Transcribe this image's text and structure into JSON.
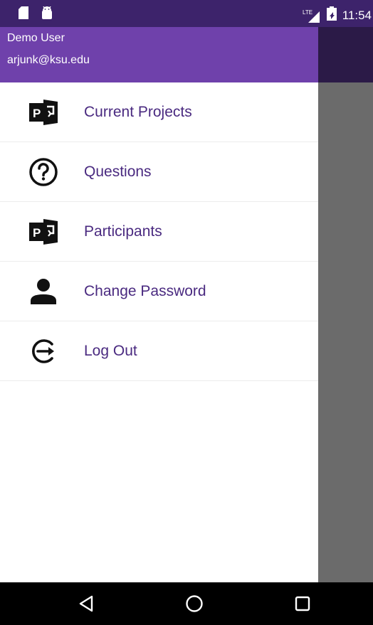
{
  "status_bar": {
    "time": "11:54",
    "network_label": "LTE",
    "left_icons": [
      "sd-card-icon",
      "android-icon"
    ]
  },
  "drawer": {
    "header": {
      "user_name": "Demo User",
      "email": "arjunk@ksu.edu"
    },
    "items": [
      {
        "label": "Current Projects",
        "icon": "project-icon"
      },
      {
        "label": "Questions",
        "icon": "question-icon"
      },
      {
        "label": "Participants",
        "icon": "project-icon"
      },
      {
        "label": "Change Password",
        "icon": "person-icon"
      },
      {
        "label": "Log Out",
        "icon": "logout-icon"
      }
    ]
  },
  "colors": {
    "header": "#6f41ab",
    "status_bar": "#3d236b",
    "label": "#4a2a80",
    "scrim": "#6b6b6b"
  },
  "nav_bar": {
    "buttons": [
      "back-icon",
      "home-icon",
      "recents-icon"
    ]
  }
}
